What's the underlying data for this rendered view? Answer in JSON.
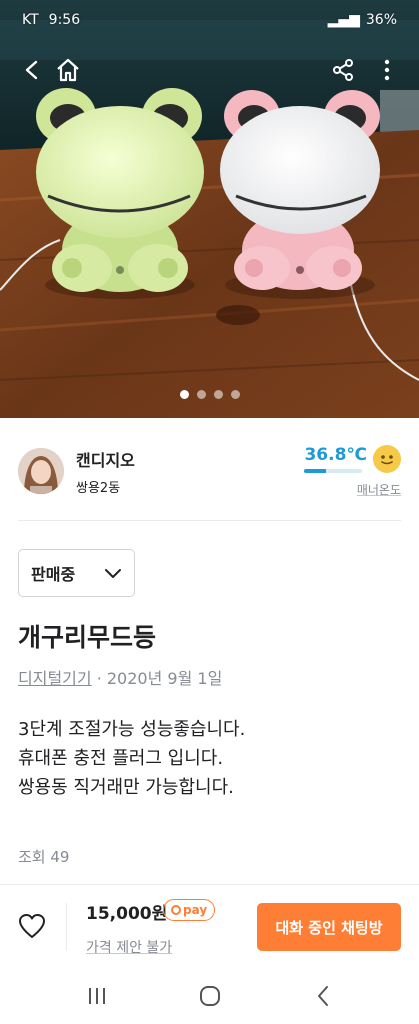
{
  "status_bar": {
    "carrier": "KT",
    "time": "9:56",
    "battery": "36%"
  },
  "photo": {
    "dots_total": 4,
    "dots_active": 0
  },
  "profile": {
    "name": "캔디지오",
    "region": "쌍용2동",
    "temperature": "36.8℃",
    "temperature_value": 36.8,
    "manner_label": "매너온도"
  },
  "status_select": {
    "value": "판매중"
  },
  "post": {
    "title": "개구리무드등",
    "category": "디지털기기",
    "separator": " · ",
    "date": "2020년 9월 1일",
    "description": "3단계 조절가능 성능좋습니다.\n휴대폰 충전 플러그 입니다.\n쌍용동  직거래만 가능합니다.",
    "views": "조회 49"
  },
  "bottom_bar": {
    "price": "15,000원",
    "pay_badge": "pay",
    "price_note": "가격 제안 불가",
    "chat_button": "대화 중인 채팅방"
  },
  "colors": {
    "accent": "#ff7e36",
    "temperature": "#1f9ad6"
  }
}
